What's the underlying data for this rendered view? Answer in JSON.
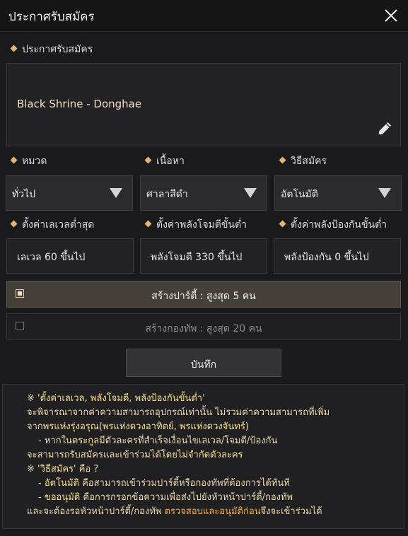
{
  "header": {
    "title": "ประกาศรับสมัคร"
  },
  "recruit": {
    "label": "ประกาศรับสมัคร",
    "name": "Black Shrine - Donghae"
  },
  "filters": [
    {
      "label": "หมวด",
      "value": "ทั่วไป"
    },
    {
      "label": "เนื้อหา",
      "value": "ศาลาสีดำ"
    },
    {
      "label": "วิธีสมัคร",
      "value": "อัตโนมัติ"
    }
  ],
  "requirements": [
    {
      "label": "ตั้งค่าเลเวลต่ำสุด",
      "value": "เลเวล 60 ขึ้นไป"
    },
    {
      "label": "ตั้งค่าพลังโจมตีขั้นต่ำ",
      "value": "พลังโจมตี 330 ขึ้นไป"
    },
    {
      "label": "ตั้งค่าพลังป้องกันขั้นต่ำ",
      "value": "พลังป้องกัน 0 ขึ้นไป"
    }
  ],
  "options": [
    {
      "label": "สร้างปาร์ตี้ : สูงสุด 5 คน",
      "selected": true
    },
    {
      "label": "สร้างกองทัพ : สูงสุด 20 คน",
      "selected": false
    }
  ],
  "save_label": "บันทึก",
  "notes": {
    "l1a": "※ '",
    "l1b": "ตั้งค่าเลเวล, พลังโจมตี, พลังป้องกันขั้นต่ำ",
    "l1c": "'",
    "l2": "จะพิจารณาจากค่าความสามารถอุปกรณ์เท่านั้น ไม่รวมค่าความสามารถที่เพิ่ม",
    "l3a": "จาก",
    "l3b": "พรแห่งรุ่งอรุณ(พรแห่งดวงอาทิตย์, พรแห่งดวงจันทร์)",
    "l4a": "- หากใน",
    "l4b": "ตระกูล",
    "l4c": "มีตัวละครที่สำเร็จเงื่อนไขเลเวล/โจมตี/ป้องกัน",
    "l5a": "จะสามารถรับสมัครและเข้าร่วมได้",
    "l5b": "โดยไม่จำกัดตัวละคร",
    "l6a": "※ '",
    "l6b": "วิธีสมัคร",
    "l6c": "' คือ ?",
    "l7a": "- ",
    "l7b": "อัตโนมัติ",
    "l7c": " คือสามารถเข้าร่วมปาร์ตี้หรือกองทัพที่ต้องการได้ทันที",
    "l8a": "- ",
    "l8b": "ขออนุมัติ",
    "l8c": " คือการกรอกข้อความเพื่อส่งไปยังหัวหน้าปาร์ตี้/กองทัพ",
    "l9a": "และจะต้องรอหัวหน้าปาร์ตี้/กองทัพ ",
    "l9b": "ตรวจสอบและอนุมัติก่อน",
    "l9c": "จึงจะเข้าร่วมได้"
  },
  "colors": {
    "accent_diamond": "#e6b56a",
    "note_text": "#e9d8b4",
    "note_highlight_yellow": "#f5e09a",
    "note_highlight_orange": "#f0b24e",
    "selected_row": "#45403a"
  },
  "icons": [
    "close-icon",
    "pencil-icon",
    "dropdown-arrow-icon",
    "diamond-bullet-icon",
    "checkbox-icon"
  ]
}
